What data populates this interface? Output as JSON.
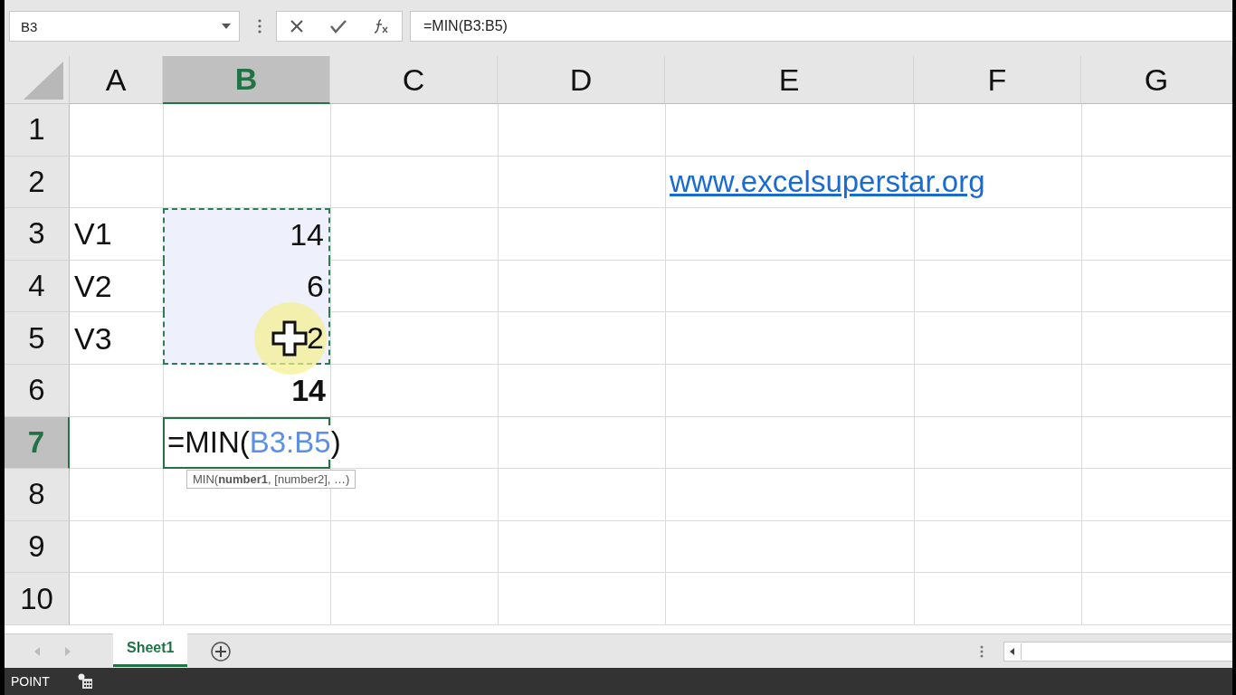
{
  "name_box": {
    "value": "B3"
  },
  "formula_bar": {
    "value": "=MIN(B3:B5)"
  },
  "columns": [
    {
      "label": "A",
      "selected": false
    },
    {
      "label": "B",
      "selected": true
    },
    {
      "label": "C",
      "selected": false
    },
    {
      "label": "D",
      "selected": false
    },
    {
      "label": "E",
      "selected": false
    },
    {
      "label": "F",
      "selected": false
    },
    {
      "label": "G",
      "selected": false
    }
  ],
  "rows": [
    {
      "label": "1",
      "selected": false
    },
    {
      "label": "2",
      "selected": false,
      "cells": {
        "E": {
          "kind": "link",
          "text": "www.excelsuperstar.org"
        }
      }
    },
    {
      "label": "3",
      "selected": false,
      "cells": {
        "A": {
          "kind": "text",
          "text": "V1"
        },
        "B": {
          "kind": "number",
          "text": "14",
          "in_range": true
        }
      }
    },
    {
      "label": "4",
      "selected": false,
      "cells": {
        "A": {
          "kind": "text",
          "text": "V2"
        },
        "B": {
          "kind": "number",
          "text": "6",
          "in_range": true
        }
      }
    },
    {
      "label": "5",
      "selected": false,
      "cells": {
        "A": {
          "kind": "text",
          "text": "V3"
        },
        "B": {
          "kind": "number",
          "text": "2",
          "in_range": true,
          "cursor": true
        }
      }
    },
    {
      "label": "6",
      "selected": false,
      "cells": {
        "B": {
          "kind": "number",
          "text": "14",
          "bold": true
        }
      }
    },
    {
      "label": "7",
      "selected": true,
      "cells": {
        "B": {
          "kind": "editing",
          "parts": [
            {
              "kind": "plain",
              "text": "=MIN("
            },
            {
              "kind": "reference",
              "text": "B3:B5"
            },
            {
              "kind": "plain",
              "text": ")"
            }
          ],
          "tooltip": "MIN(**number1**, [number2], …)"
        }
      }
    },
    {
      "label": "8",
      "selected": false
    },
    {
      "label": "9",
      "selected": false
    },
    {
      "label": "10",
      "selected": false
    }
  ],
  "sheet_tabs": [
    {
      "label": "Sheet1",
      "selected": true
    }
  ],
  "status_bar": {
    "mode": "POINT"
  }
}
